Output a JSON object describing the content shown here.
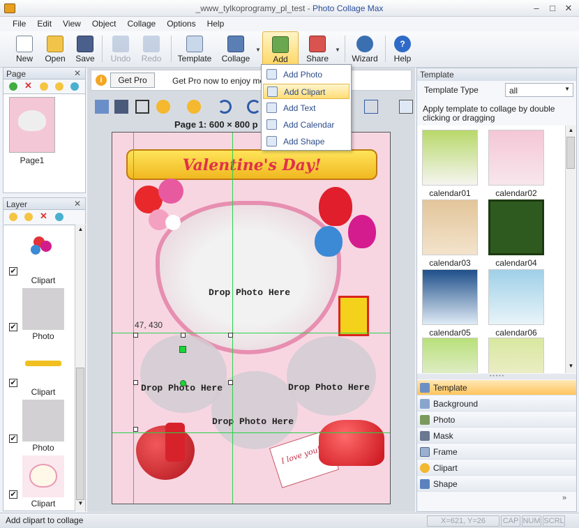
{
  "window": {
    "title_prefix": "_www_tylkoprogramy_pl_test - ",
    "app_name": "Photo Collage Max"
  },
  "menu": [
    "File",
    "Edit",
    "View",
    "Object",
    "Collage",
    "Options",
    "Help"
  ],
  "toolbar": {
    "new": "New",
    "open": "Open",
    "save": "Save",
    "undo": "Undo",
    "redo": "Redo",
    "template": "Template",
    "collage": "Collage",
    "add": "Add",
    "share": "Share",
    "wizard": "Wizard",
    "help": "Help"
  },
  "add_menu": [
    "Add Photo",
    "Add Clipart",
    "Add Text",
    "Add Calendar",
    "Add Shape"
  ],
  "page_panel": {
    "title": "Page",
    "pages": [
      "Page1"
    ]
  },
  "layer_panel": {
    "title": "Layer",
    "layers": [
      "Clipart",
      "Photo",
      "Clipart",
      "Photo",
      "Clipart"
    ]
  },
  "infobar": {
    "button": "Get Pro",
    "text": "Get Pro now to enjoy more"
  },
  "canvas": {
    "page_label": "Page 1: 600 × 800 p",
    "coord_label": "47, 430",
    "drop_text": "Drop Photo Here",
    "banner_text": "Valentine's Day!",
    "card_text": "I love you!"
  },
  "template_panel": {
    "title": "Template",
    "type_label": "Template Type",
    "type_value": "all",
    "hint": "Apply template to collage by double clicking or dragging",
    "templates": [
      "calendar01",
      "calendar02",
      "calendar03",
      "calendar04",
      "calendar05",
      "calendar06"
    ]
  },
  "categories": [
    "Template",
    "Background",
    "Photo",
    "Mask",
    "Frame",
    "Clipart",
    "Shape"
  ],
  "status": {
    "text": "Add clipart to collage",
    "coords": "X=621, Y=26",
    "cap": "CAP",
    "num": "NUM",
    "scrl": "SCRL"
  },
  "colors": {
    "accent": "#ffc45e",
    "guide": "#29d34a",
    "canvas_bg": "#f7d6e2"
  }
}
